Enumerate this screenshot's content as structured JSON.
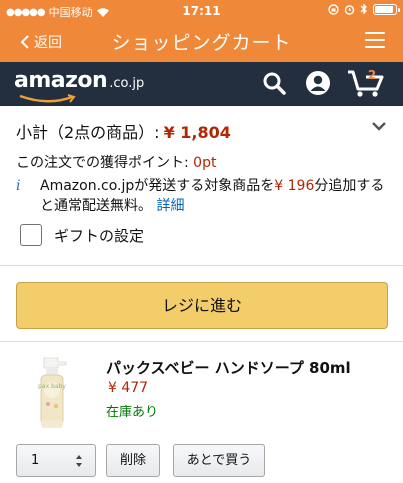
{
  "status_bar": {
    "carrier": "中国移动",
    "time": "17:11"
  },
  "nav": {
    "back_label": "返回",
    "title": "ショッピングカート"
  },
  "amazon_header": {
    "logo_text": "amazon",
    "logo_tld": ".co.jp",
    "cart_count": "2"
  },
  "subtotal": {
    "label": "小計（2点の商品）:",
    "price": "¥ 1,804",
    "points_label": "この注文での獲得ポイント: ",
    "points_value": "0pt"
  },
  "shipping_info": {
    "text_before": "Amazon.co.jpが発送する対象商品を",
    "amount": "¥ 196",
    "text_after": "分追加すると通常配送無料。",
    "link": "詳細"
  },
  "gift": {
    "label": "ギフトの設定"
  },
  "checkout": {
    "label": "レジに進む"
  },
  "product": {
    "title": "パックスベビー ハンドソープ 80ml",
    "price": "¥ 477",
    "stock": "在庫あり",
    "image_label": "pax baby"
  },
  "item_actions": {
    "quantity": "1",
    "delete_label": "削除",
    "later_label": "あとで買う"
  },
  "colors": {
    "nav_orange": "#f0883a",
    "amazon_dark": "#232f3e",
    "price_red": "#b12704",
    "stock_green": "#007600",
    "checkout_yellow": "#f3cd6a",
    "link_blue": "#0066c0"
  }
}
